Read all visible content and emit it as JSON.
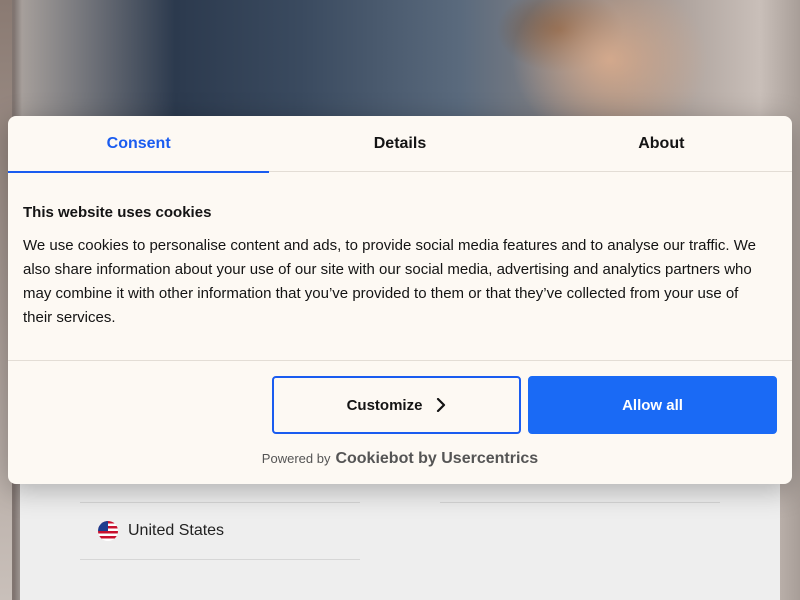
{
  "background": {
    "country": {
      "flag_icon": "us-flag-icon",
      "label": "United States"
    }
  },
  "dialog": {
    "tabs": [
      {
        "label": "Consent",
        "active": true
      },
      {
        "label": "Details",
        "active": false
      },
      {
        "label": "About",
        "active": false
      }
    ],
    "heading": "This website uses cookies",
    "body": "We use cookies to personalise content and ads, to provide social media features and to analyse our traffic. We also share information about your use of our site with our social media, advertising and analytics partners who may combine it with other information that you’ve provided to them or that they’ve collected from your use of their services.",
    "buttons": {
      "customize_label": "Customize",
      "customize_icon": "chevron-right-icon",
      "allow_all_label": "Allow all"
    },
    "footer": {
      "powered_prefix": "Powered by",
      "brand": "Cookiebot by Usercentrics"
    }
  },
  "colors": {
    "accent": "#1a5cf0",
    "button_primary": "#1a6af5",
    "dialog_background": "#fdf9f3",
    "text": "#141414"
  }
}
